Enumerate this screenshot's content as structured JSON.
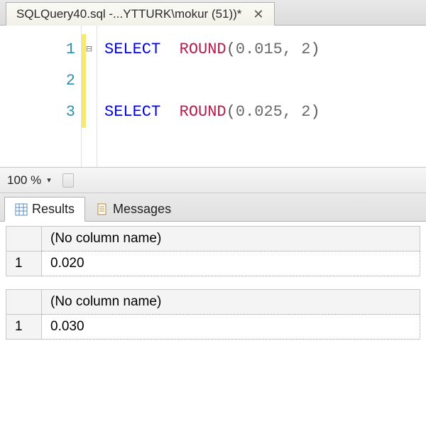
{
  "tab": {
    "title": "SQLQuery40.sql -...YTTURK\\mokur (51))*",
    "close_glyph": "✕"
  },
  "editor": {
    "lines": [
      "1",
      "2",
      "3"
    ],
    "fold_glyph": "⊟",
    "code": {
      "l1_kw": "SELECT",
      "l1_fn": "ROUND",
      "l1_open": "(",
      "l1_arg": "0.015, 2",
      "l1_close": ")",
      "l3_kw": "SELECT",
      "l3_fn": "ROUND",
      "l3_open": "(",
      "l3_arg": "0.025, 2",
      "l3_close": ")"
    }
  },
  "zoom": {
    "value": "100 %",
    "caret": "▾"
  },
  "subtabs": {
    "results": "Results",
    "messages": "Messages"
  },
  "results": [
    {
      "header": "(No column name)",
      "rownum": "1",
      "value": "0.020"
    },
    {
      "header": "(No column name)",
      "rownum": "1",
      "value": "0.030"
    }
  ]
}
